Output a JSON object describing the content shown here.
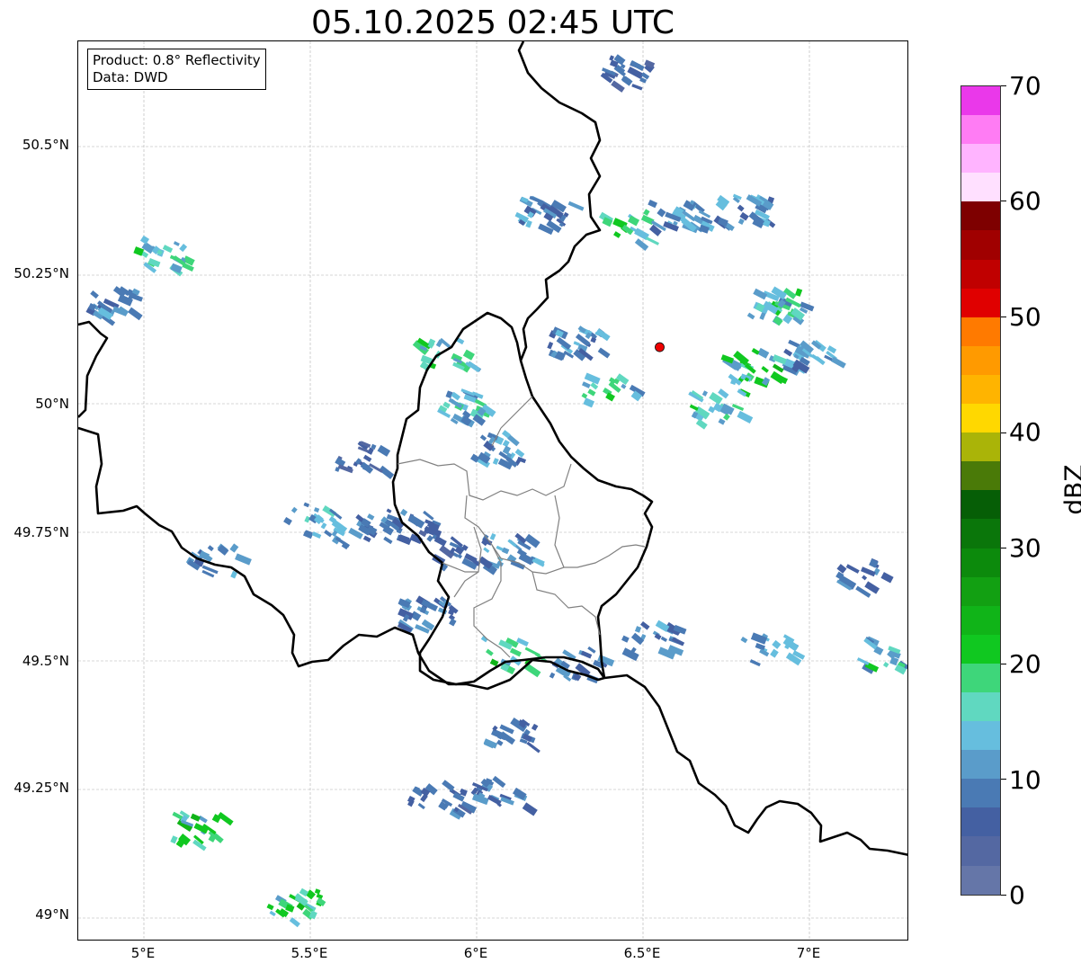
{
  "title": "05.10.2025 02:45 UTC",
  "info": {
    "product": "Product: 0.8° Reflectivity",
    "source": "Data: DWD"
  },
  "axes": {
    "lon_ticks": [
      "5°E",
      "5.5°E",
      "6°E",
      "6.5°E",
      "7°E"
    ],
    "lat_ticks": [
      "50.5°N",
      "50.25°N",
      "50°N",
      "49.75°N",
      "49.5°N",
      "49.25°N",
      "49°N"
    ]
  },
  "colorbar": {
    "label": "dBZ",
    "ticks": [
      "0",
      "10",
      "20",
      "30",
      "40",
      "50",
      "60",
      "70"
    ],
    "colors": [
      "#6576a8",
      "#5468a2",
      "#4460a2",
      "#4a7ab4",
      "#5a9cca",
      "#66bede",
      "#60d8c0",
      "#3ed67a",
      "#10c820",
      "#10b418",
      "#12a012",
      "#0c8a0c",
      "#0a760a",
      "#065e06",
      "#4a7a08",
      "#aab408",
      "#ffd800",
      "#ffb400",
      "#ff9a00",
      "#ff7a00",
      "#e00000",
      "#c00000",
      "#a00000",
      "#7e0000",
      "#ffe0ff",
      "#ffb4ff",
      "#ff7cf4",
      "#ea38ea"
    ]
  },
  "chart_data": {
    "type": "map",
    "lon_range": [
      4.8,
      7.3
    ],
    "lat_range": [
      48.95,
      50.7
    ],
    "grid": true,
    "marker": {
      "lon": 6.55,
      "lat": 50.11,
      "color": "#ee0000"
    },
    "echo_clusters": [
      {
        "lon": 4.9,
        "lat": 50.2,
        "dbz": 12
      },
      {
        "lon": 5.05,
        "lat": 50.3,
        "dbz": 20
      },
      {
        "lon": 5.9,
        "lat": 50.1,
        "dbz": 22
      },
      {
        "lon": 5.95,
        "lat": 50.0,
        "dbz": 18
      },
      {
        "lon": 6.05,
        "lat": 49.92,
        "dbz": 14
      },
      {
        "lon": 5.65,
        "lat": 49.9,
        "dbz": 10
      },
      {
        "lon": 5.5,
        "lat": 49.78,
        "dbz": 16
      },
      {
        "lon": 5.65,
        "lat": 49.76,
        "dbz": 12
      },
      {
        "lon": 5.8,
        "lat": 49.77,
        "dbz": 10
      },
      {
        "lon": 6.1,
        "lat": 49.72,
        "dbz": 14
      },
      {
        "lon": 5.95,
        "lat": 49.72,
        "dbz": 10
      },
      {
        "lon": 6.1,
        "lat": 49.52,
        "dbz": 22
      },
      {
        "lon": 5.85,
        "lat": 49.6,
        "dbz": 12
      },
      {
        "lon": 6.3,
        "lat": 49.5,
        "dbz": 12
      },
      {
        "lon": 6.45,
        "lat": 50.35,
        "dbz": 20
      },
      {
        "lon": 6.2,
        "lat": 50.38,
        "dbz": 14
      },
      {
        "lon": 6.6,
        "lat": 50.37,
        "dbz": 14
      },
      {
        "lon": 6.8,
        "lat": 50.38,
        "dbz": 14
      },
      {
        "lon": 6.9,
        "lat": 50.2,
        "dbz": 20
      },
      {
        "lon": 7.0,
        "lat": 50.1,
        "dbz": 14
      },
      {
        "lon": 6.82,
        "lat": 50.08,
        "dbz": 22
      },
      {
        "lon": 6.72,
        "lat": 50.0,
        "dbz": 20
      },
      {
        "lon": 6.4,
        "lat": 50.04,
        "dbz": 20
      },
      {
        "lon": 6.3,
        "lat": 50.13,
        "dbz": 14
      },
      {
        "lon": 6.88,
        "lat": 49.53,
        "dbz": 14
      },
      {
        "lon": 7.2,
        "lat": 49.52,
        "dbz": 20
      },
      {
        "lon": 7.15,
        "lat": 49.67,
        "dbz": 10
      },
      {
        "lon": 5.15,
        "lat": 49.18,
        "dbz": 22
      },
      {
        "lon": 5.45,
        "lat": 49.03,
        "dbz": 22
      },
      {
        "lon": 6.1,
        "lat": 49.37,
        "dbz": 12
      },
      {
        "lon": 6.07,
        "lat": 49.25,
        "dbz": 12
      },
      {
        "lon": 5.88,
        "lat": 49.24,
        "dbz": 10
      },
      {
        "lon": 5.2,
        "lat": 49.7,
        "dbz": 14
      },
      {
        "lon": 6.52,
        "lat": 49.55,
        "dbz": 12
      },
      {
        "lon": 6.45,
        "lat": 50.65,
        "dbz": 10
      }
    ]
  }
}
